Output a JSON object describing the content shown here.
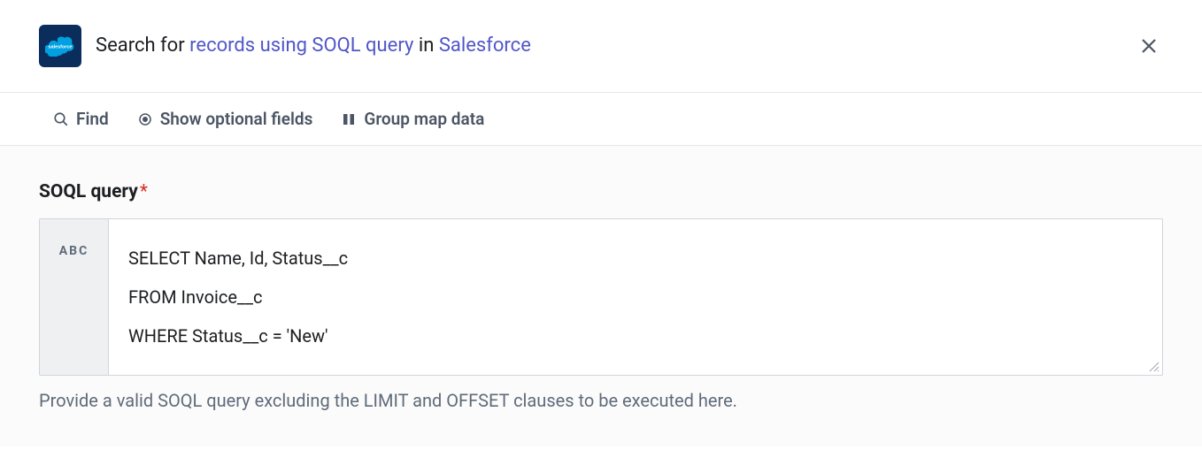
{
  "header": {
    "title_prefix": "Search for ",
    "title_link1": "records using SOQL query",
    "title_mid": " in ",
    "title_link2": "Salesforce"
  },
  "toolbar": {
    "find_label": "Find",
    "optional_fields_label": "Show optional fields",
    "group_map_label": "Group map data"
  },
  "field": {
    "label": "SOQL query",
    "required_mark": "*",
    "type_badge": "ABC",
    "query_value": "SELECT Name, Id, Status__c\nFROM Invoice__c\nWHERE Status__c = 'New'",
    "help_text": "Provide a valid SOQL query excluding the LIMIT and OFFSET clauses to be executed here."
  }
}
